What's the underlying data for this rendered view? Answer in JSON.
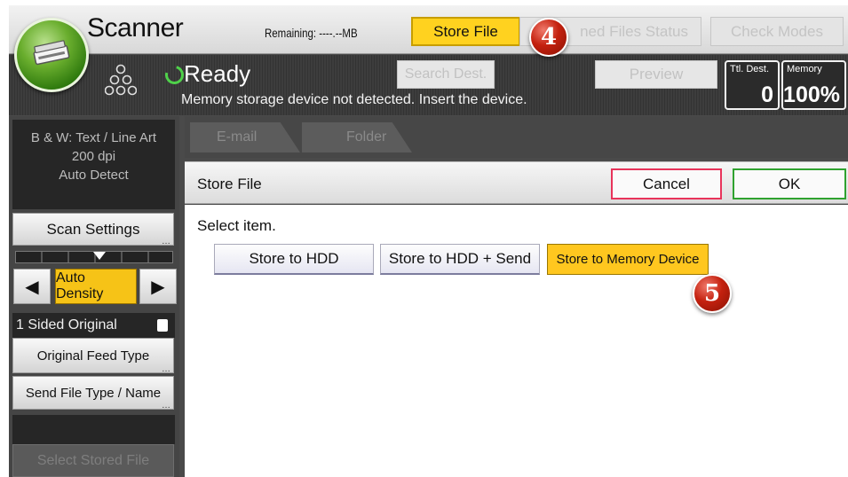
{
  "header": {
    "app_title": "Scanner",
    "remaining_label": "Remaining: ----.--MB",
    "store_file_label": "Store File",
    "scanned_files_label": "ned Files Status",
    "check_modes_label": "Check Modes"
  },
  "status": {
    "ready_text": "Ready",
    "message": "Memory storage device not detected. Insert the device.",
    "search_dest_label": "Search Dest.",
    "preview_label": "Preview",
    "ttl_dest_label": "Ttl. Dest.",
    "ttl_dest_value": "0",
    "memory_label": "Memory",
    "memory_value": "100%"
  },
  "left_panel": {
    "scan_mode": "B & W: Text / Line Art",
    "resolution": "200 dpi",
    "detect": "Auto Detect",
    "scan_settings_label": "Scan Settings",
    "auto_density_label": "Auto Density",
    "sided_label": "1 Sided Original",
    "feed_type_label": "Original Feed Type",
    "send_file_type_label": "Send File Type / Name",
    "select_stored_label": "Select Stored File"
  },
  "tabs": {
    "email_label": "E-mail",
    "folder_label": "Folder"
  },
  "dialog": {
    "title": "Store File",
    "cancel_label": "Cancel",
    "ok_label": "OK",
    "prompt": "Select item.",
    "options": [
      {
        "label": "Store to HDD"
      },
      {
        "label": "Store to HDD + Send"
      },
      {
        "label": "Store to Memory Device"
      }
    ]
  },
  "markers": {
    "step_4": "4",
    "step_5": "5"
  },
  "colors": {
    "accent_yellow": "#ffc71f",
    "ready_green": "#4fd14a",
    "cancel_border": "#e8335a",
    "ok_border": "#2fa22f",
    "step_badge": "#c4210f"
  }
}
